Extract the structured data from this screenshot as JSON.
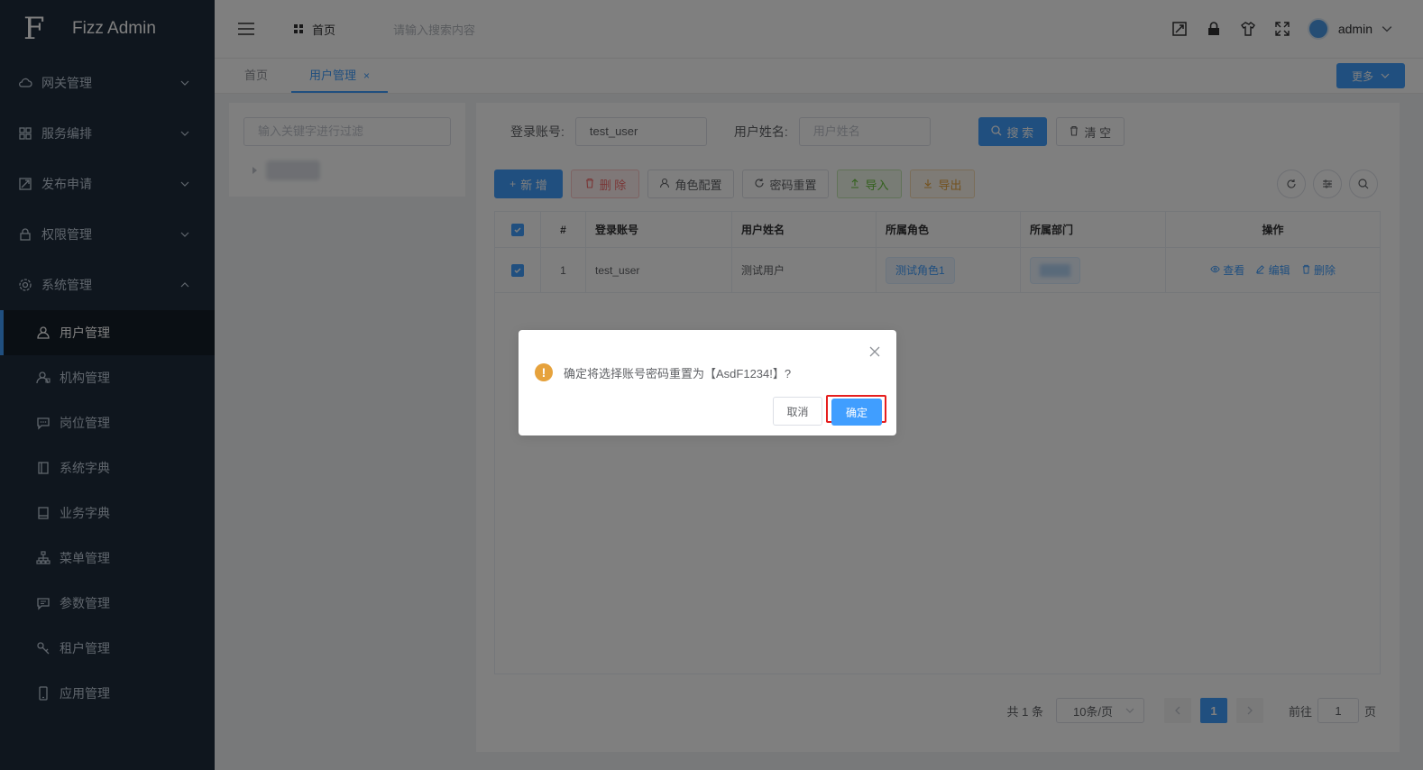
{
  "app": {
    "title": "Fizz Admin",
    "logo_glyph": "F"
  },
  "sidebar": {
    "groups": [
      {
        "label": "网关管理",
        "icon": "cloud-icon",
        "expanded": false
      },
      {
        "label": "服务编排",
        "icon": "grid-icon",
        "expanded": false
      },
      {
        "label": "发布申请",
        "icon": "publish-icon",
        "expanded": false
      },
      {
        "label": "权限管理",
        "icon": "lock-icon",
        "expanded": false
      },
      {
        "label": "系统管理",
        "icon": "gear-icon",
        "expanded": true
      }
    ],
    "sub_items": [
      {
        "label": "用户管理",
        "icon": "user-icon",
        "active": true
      },
      {
        "label": "机构管理",
        "icon": "org-icon",
        "active": false
      },
      {
        "label": "岗位管理",
        "icon": "message-icon",
        "active": false
      },
      {
        "label": "系统字典",
        "icon": "notebook-icon",
        "active": false
      },
      {
        "label": "业务字典",
        "icon": "book-icon",
        "active": false
      },
      {
        "label": "菜单管理",
        "icon": "tree-icon",
        "active": false
      },
      {
        "label": "参数管理",
        "icon": "chat-icon",
        "active": false
      },
      {
        "label": "租户管理",
        "icon": "key-icon",
        "active": false
      },
      {
        "label": "应用管理",
        "icon": "phone-icon",
        "active": false
      }
    ]
  },
  "header": {
    "breadcrumb_home": "首页",
    "search_placeholder": "请输入搜索内容",
    "username": "admin"
  },
  "tabs": {
    "items": [
      {
        "label": "首页",
        "active": false
      },
      {
        "label": "用户管理",
        "active": true,
        "closable": true
      }
    ],
    "close_glyph": "×",
    "more_label": "更多"
  },
  "tree": {
    "filter_placeholder": "输入关键字进行过滤"
  },
  "search_form": {
    "account_label": "登录账号:",
    "account_value": "test_user",
    "name_label": "用户姓名:",
    "name_placeholder": "用户姓名",
    "search_label": "搜 索",
    "clear_label": "清 空"
  },
  "toolbar": {
    "add": "新 增",
    "delete": "删 除",
    "role_config": "角色配置",
    "reset_password": "密码重置",
    "import": "导入",
    "export": "导出"
  },
  "table": {
    "columns": [
      "#",
      "登录账号",
      "用户姓名",
      "所属角色",
      "所属部门",
      "操作"
    ],
    "rows": [
      {
        "index": "1",
        "account": "test_user",
        "name": "测试用户",
        "role": "测试角色1",
        "checked": true
      }
    ],
    "actions": {
      "view": "查看",
      "edit": "编辑",
      "delete": "删除"
    }
  },
  "pagination": {
    "total": "共 1 条",
    "page_size": "10条/页",
    "current_page": "1",
    "goto_prefix": "前往",
    "goto_value": "1",
    "goto_suffix": "页"
  },
  "dialog": {
    "message": "确定将选择账号密码重置为【AsdF1234!】?",
    "cancel": "取消",
    "confirm": "确定",
    "warning_glyph": "!"
  },
  "colors": {
    "primary": "#409eff",
    "sidebar_bg": "#1f2d3d",
    "warning": "#e6a23c",
    "highlight": "#e61e1e"
  }
}
